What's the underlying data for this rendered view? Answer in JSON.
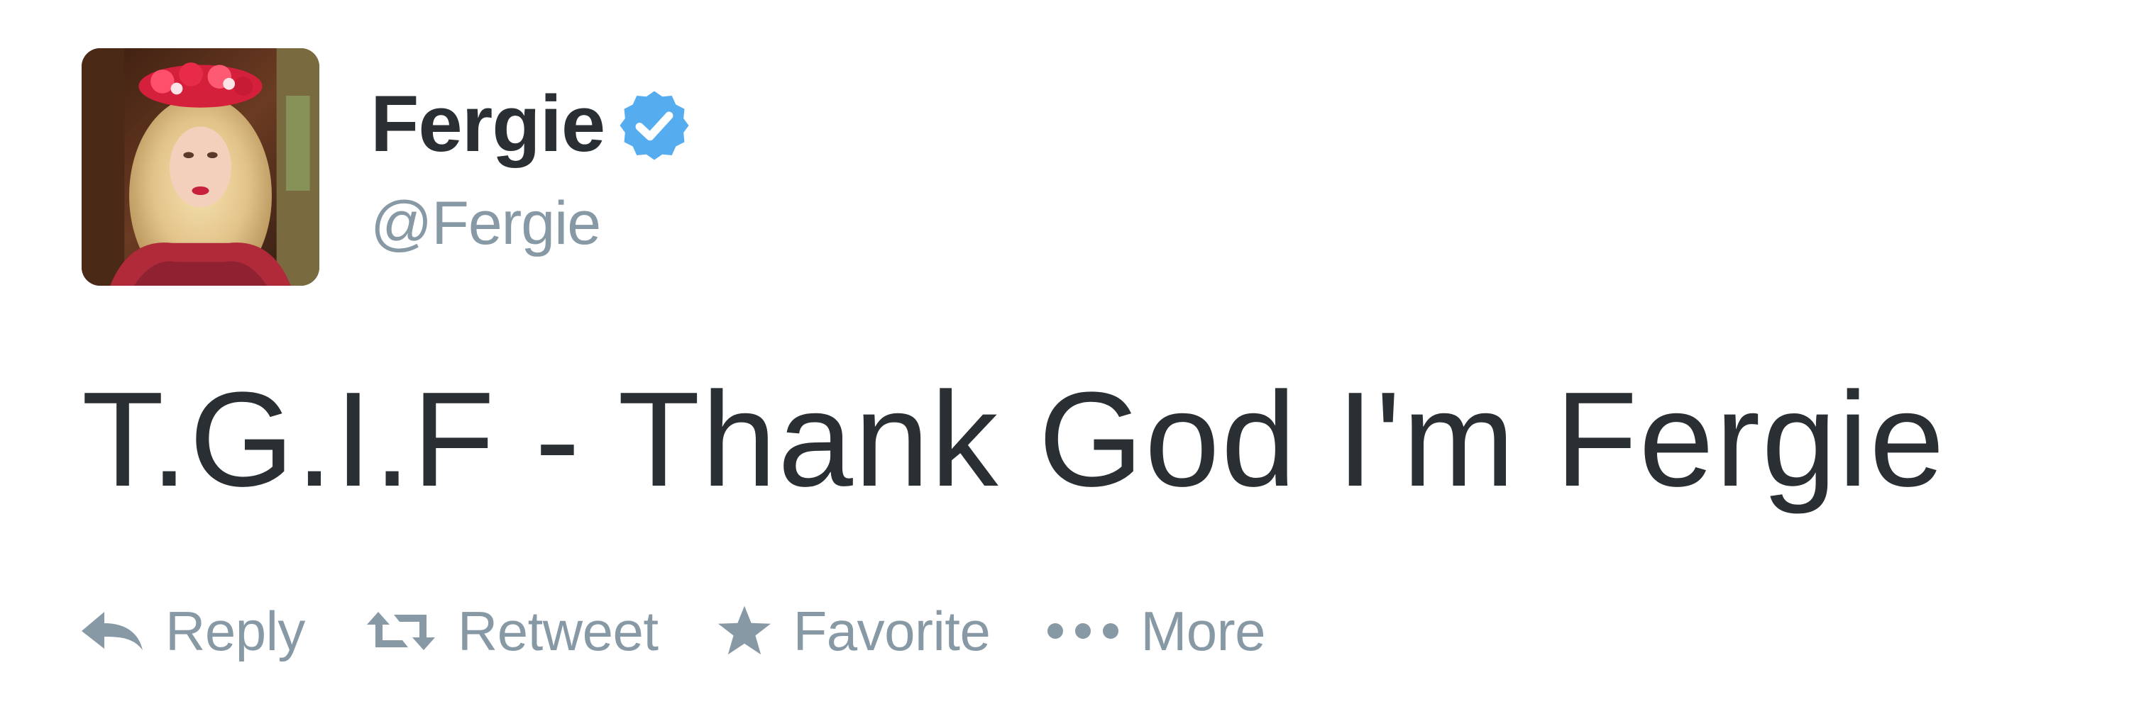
{
  "tweet": {
    "user": {
      "display_name": "Fergie",
      "screen_name": "@Fergie",
      "verified": true,
      "avatar": "profile-photo"
    },
    "text": "T.G.I.F - Thank God I'm Fergie",
    "actions": [
      {
        "label": "Reply",
        "icon": "reply-icon"
      },
      {
        "label": "Retweet",
        "icon": "retweet-icon"
      },
      {
        "label": "Favorite",
        "icon": "star-icon"
      },
      {
        "label": "More",
        "icon": "more-dots-icon"
      }
    ]
  },
  "colors": {
    "text": "#292f33",
    "secondary": "#8899a6",
    "verified": "#55acee",
    "background": "#ffffff"
  }
}
